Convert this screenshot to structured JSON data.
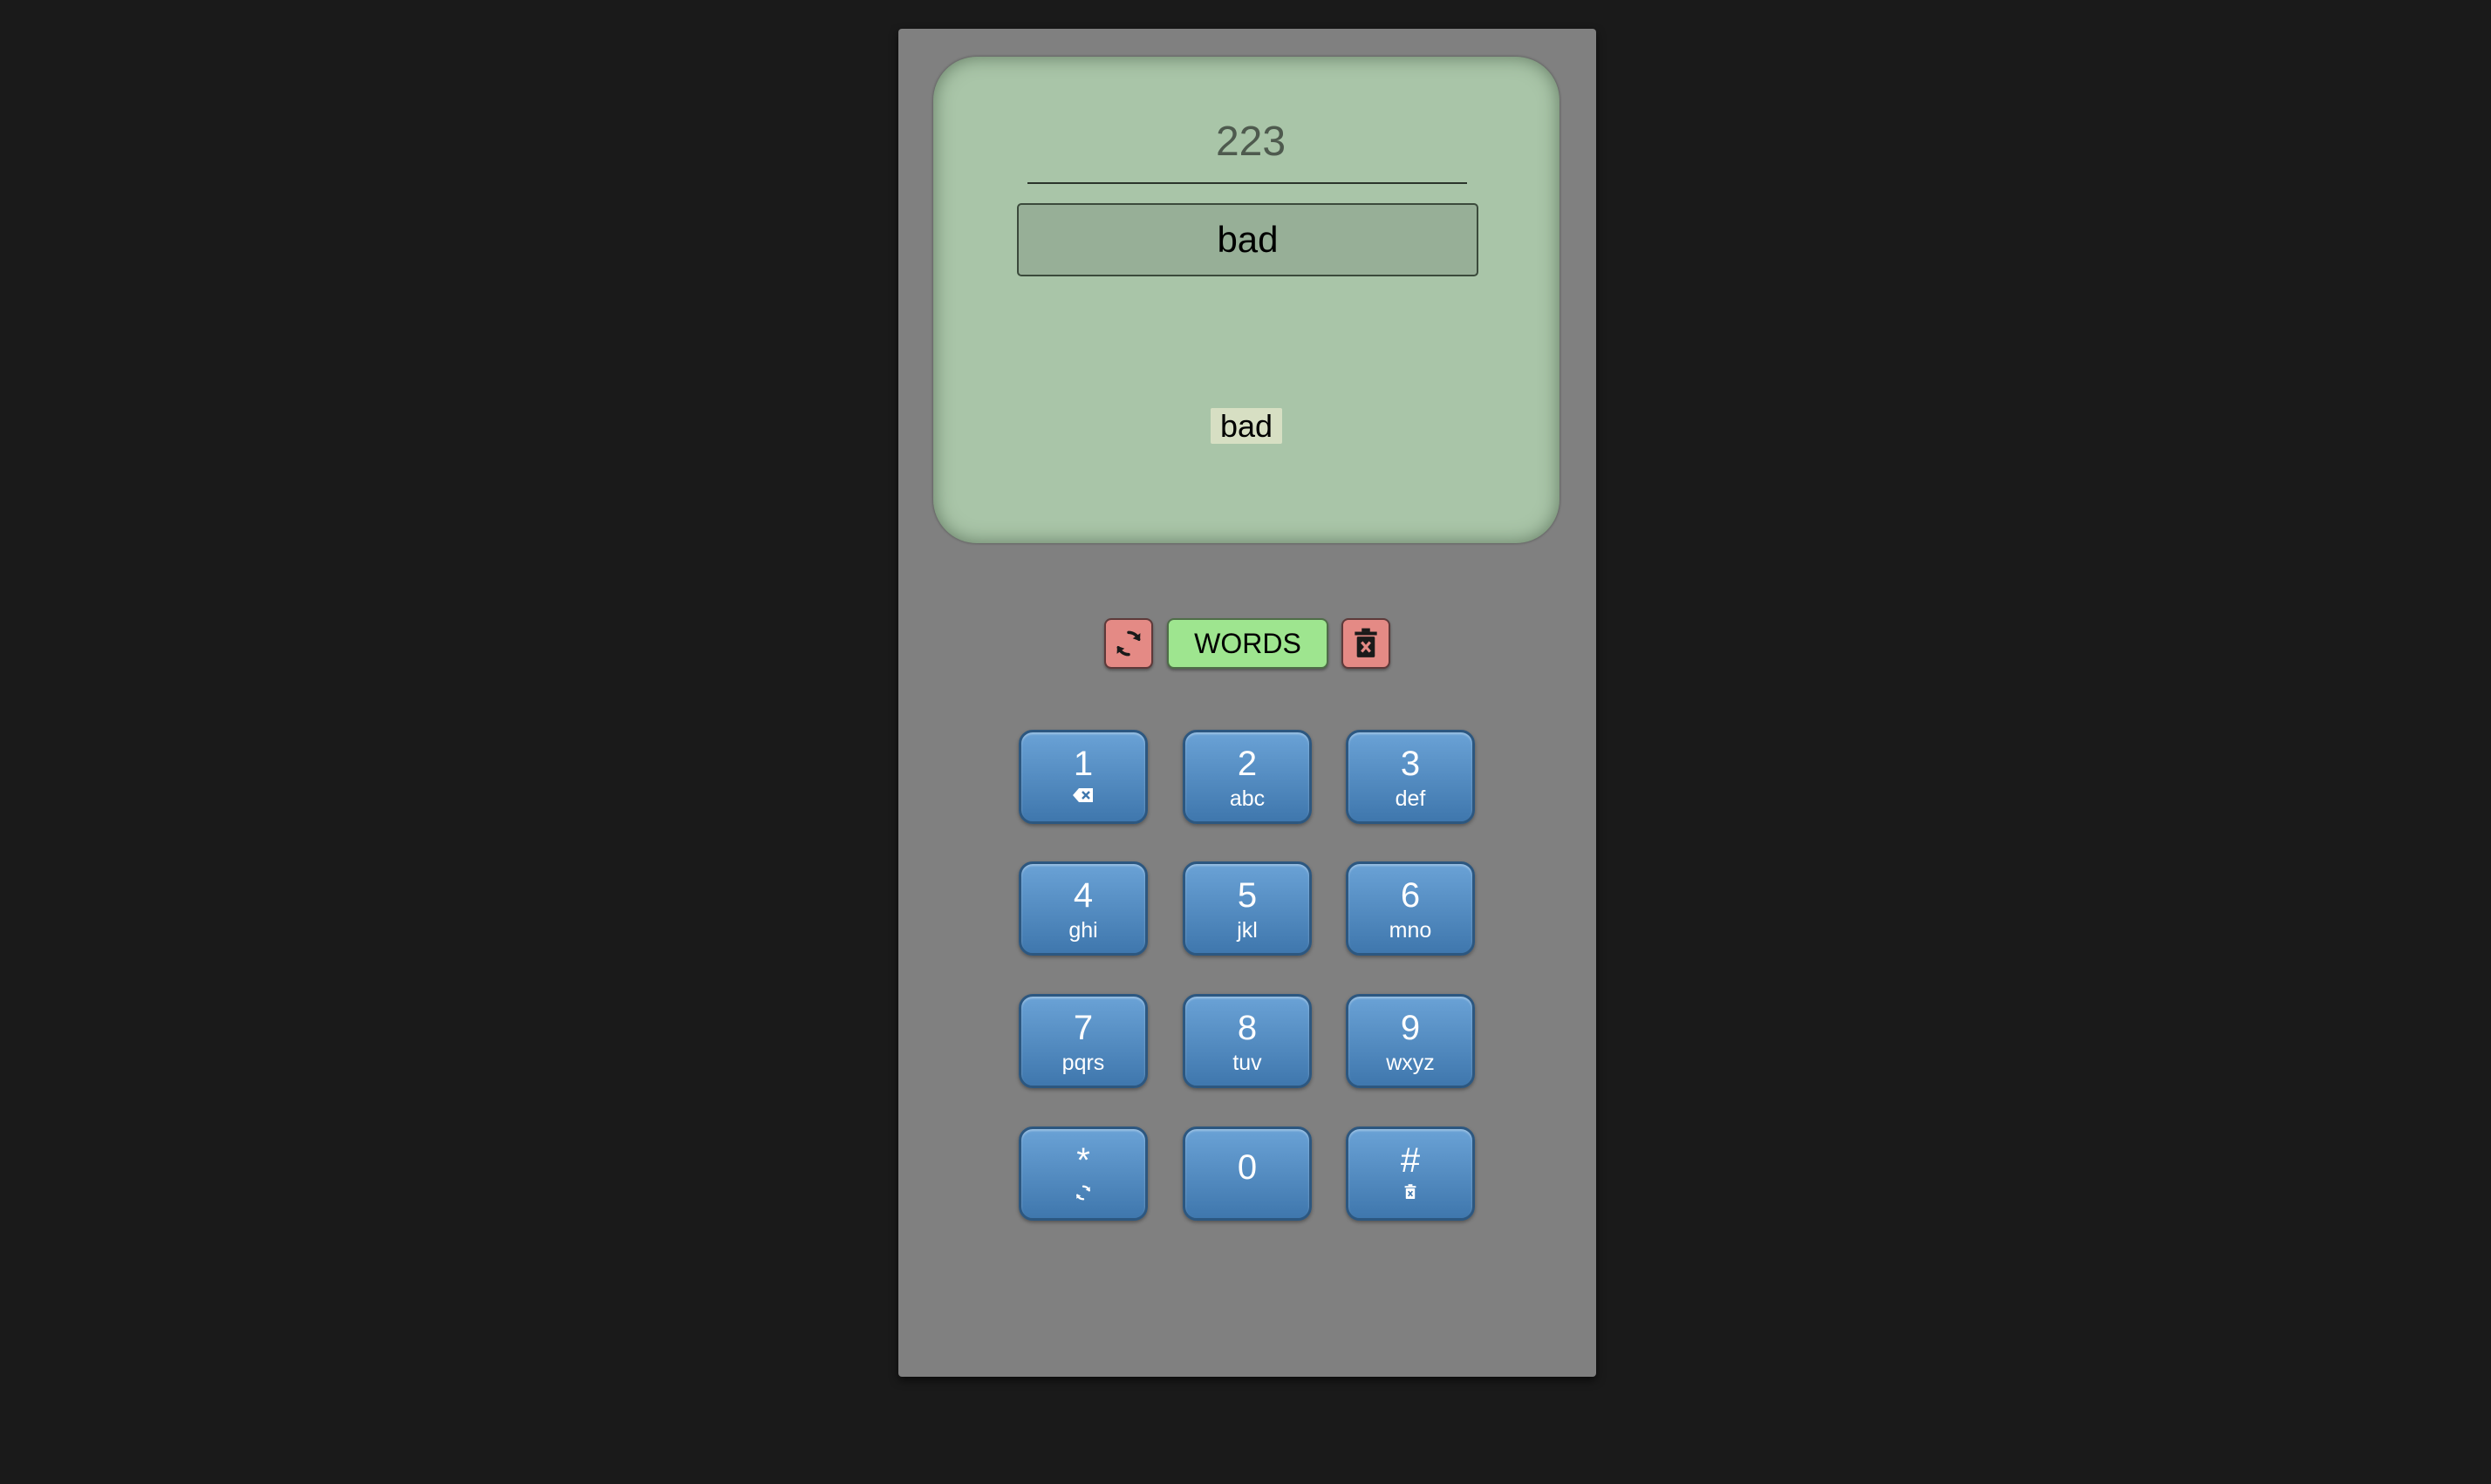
{
  "display": {
    "digits": "223",
    "current_word": "bad",
    "candidates": [
      "bad"
    ]
  },
  "controls": {
    "refresh_icon": "refresh-icon",
    "words_label": "WORDS",
    "trash_icon": "trash-icon"
  },
  "keypad": {
    "keys": [
      {
        "num": "1",
        "letters": "",
        "icon": "backspace-icon"
      },
      {
        "num": "2",
        "letters": "abc"
      },
      {
        "num": "3",
        "letters": "def"
      },
      {
        "num": "4",
        "letters": "ghi"
      },
      {
        "num": "5",
        "letters": "jkl"
      },
      {
        "num": "6",
        "letters": "mno"
      },
      {
        "num": "7",
        "letters": "pqrs"
      },
      {
        "num": "8",
        "letters": "tuv"
      },
      {
        "num": "9",
        "letters": "wxyz"
      },
      {
        "num": "*",
        "letters": "",
        "icon": "refresh-icon"
      },
      {
        "num": "0",
        "letters": ""
      },
      {
        "num": "#",
        "letters": "",
        "icon": "trash-icon"
      }
    ]
  },
  "colors": {
    "background": "#1a1a1a",
    "phone_body": "#808080",
    "screen": "#a9c5a8",
    "key_blue": "#4f87bf",
    "control_red": "#e48a85",
    "words_green": "#9ee58f"
  }
}
